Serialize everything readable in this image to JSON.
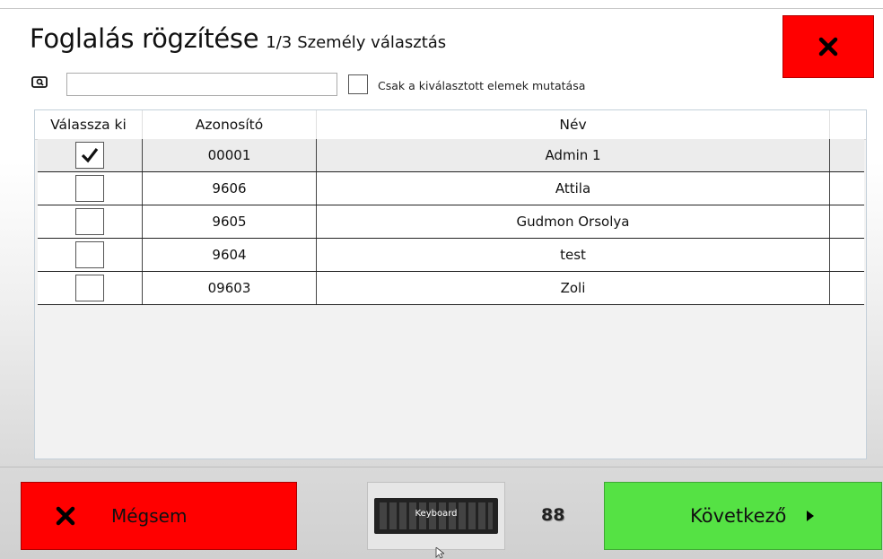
{
  "header": {
    "title": "Foglalás rögzítése",
    "step": "1/3",
    "subtitle": "Személy választás"
  },
  "search": {
    "value": "",
    "placeholder": "",
    "icon": "search-icon"
  },
  "filter": {
    "label": "Csak a kiválasztott elemek mutatása",
    "checked": false
  },
  "table": {
    "columns": [
      "Válassza ki",
      "Azonosító",
      "Név"
    ],
    "rows": [
      {
        "selected": true,
        "id": "00001",
        "name": "Admin 1"
      },
      {
        "selected": false,
        "id": "9606",
        "name": "Attila"
      },
      {
        "selected": false,
        "id": "9605",
        "name": "Gudmon Orsolya"
      },
      {
        "selected": false,
        "id": "9604",
        "name": "test"
      },
      {
        "selected": false,
        "id": "09603",
        "name": "Zoli"
      }
    ]
  },
  "footer": {
    "cancel_label": "Mégsem",
    "keyboard_label": "Keyboard",
    "counter": "88",
    "next_label": "Következő"
  },
  "colors": {
    "cancel": "#ff0000",
    "close": "#ff0000",
    "next": "#55e244"
  }
}
